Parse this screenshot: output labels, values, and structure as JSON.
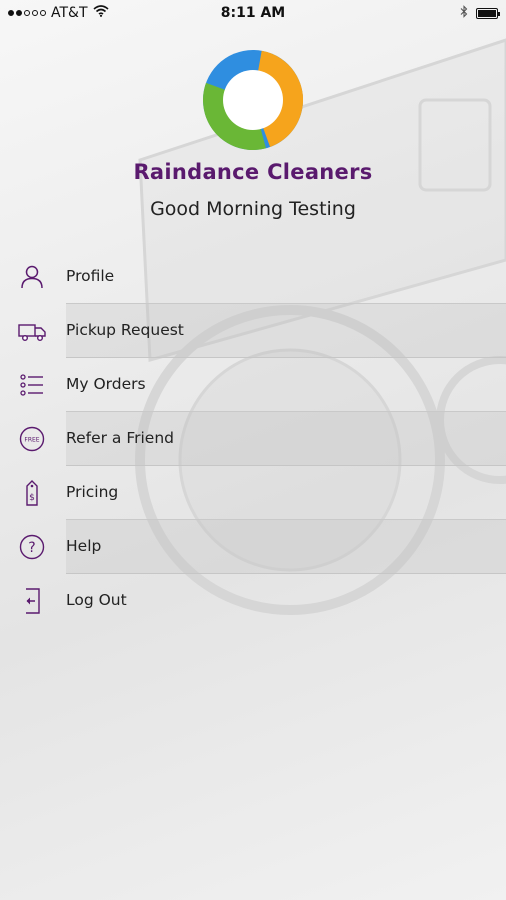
{
  "status_bar": {
    "carrier": "AT&T",
    "time": "8:11 AM"
  },
  "header": {
    "brand_name": "Raindance Cleaners",
    "greeting": "Good Morning Testing"
  },
  "colors": {
    "accent": "#5a1a6e",
    "logo_blue": "#2f8ee0",
    "logo_orange": "#f6a41c",
    "logo_green": "#6ab736"
  },
  "menu": {
    "items": [
      {
        "label": "Profile",
        "icon": "person-icon"
      },
      {
        "label": "Pickup Request",
        "icon": "truck-icon"
      },
      {
        "label": "My Orders",
        "icon": "list-icon"
      },
      {
        "label": "Refer a Friend",
        "icon": "free-badge-icon",
        "icon_text": "FREE"
      },
      {
        "label": "Pricing",
        "icon": "price-tag-icon"
      },
      {
        "label": "Help",
        "icon": "help-icon"
      },
      {
        "label": "Log Out",
        "icon": "logout-icon"
      }
    ]
  }
}
